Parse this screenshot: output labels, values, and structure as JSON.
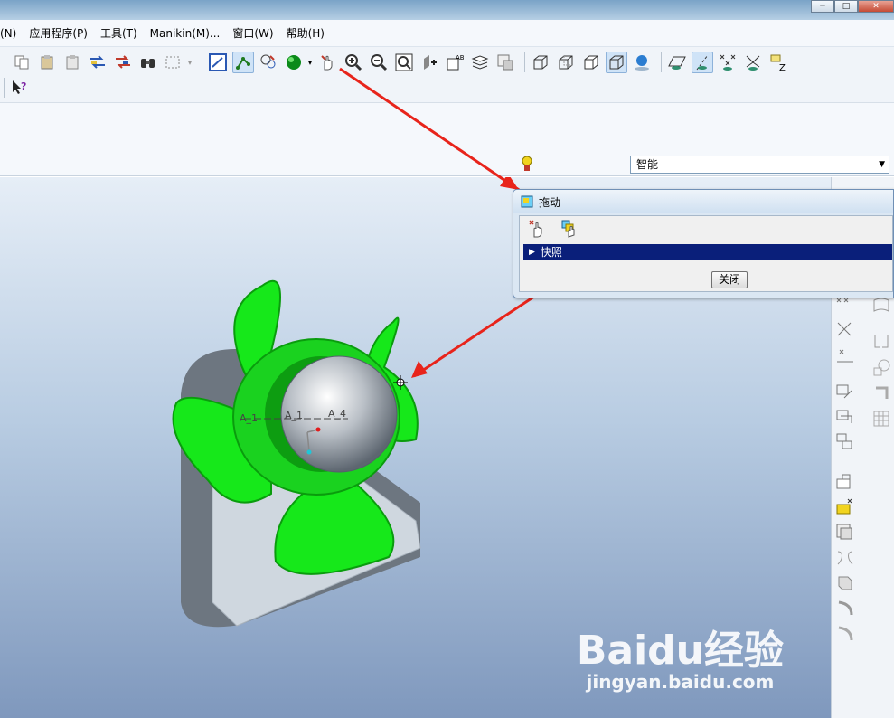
{
  "window": {
    "controls": [
      "─",
      "□",
      "✕"
    ]
  },
  "menubar": {
    "items": [
      {
        "label": "(N)"
      },
      {
        "label": "应用程序(P)"
      },
      {
        "label": "工具(T)"
      },
      {
        "label": "Manikin(M)..."
      },
      {
        "label": "窗口(W)"
      },
      {
        "label": "帮助(H)"
      }
    ]
  },
  "toolbar": {
    "row1_icons": [
      "copy-icon",
      "paste-icon",
      "paste-special-icon",
      "regenerate-icon",
      "regenerate-manager-icon",
      "find-icon",
      "select-box-icon",
      "refit-icon",
      "spin-center-icon",
      "datum-display-icon",
      "appearance-icon",
      "drag-components-icon",
      "zoom-in-icon",
      "zoom-out-icon",
      "refit-view-icon",
      "reorient-icon",
      "saved-views-icon",
      "layers-icon",
      "view-manager-icon",
      "wireframe-icon",
      "hidden-line-icon",
      "no-hidden-icon",
      "shading-icon",
      "enhanced-realism-icon",
      "datum-planes-icon",
      "datum-axes-icon",
      "datum-points-icon",
      "coord-sys-icon",
      "annotation-icon"
    ],
    "row2_icons": [
      "context-help-icon"
    ]
  },
  "filter": {
    "selected": "智能",
    "light_icon": "light-bulb-icon"
  },
  "dialog": {
    "title": "拖动",
    "tools": [
      "drag-point-icon",
      "drag-body-icon"
    ],
    "snapshot_label": "快照",
    "close_label": "关闭"
  },
  "model": {
    "axis_labels": [
      "A_1",
      "A_1",
      "A_4"
    ]
  },
  "right_rail": {
    "icons": [
      "datum-point-icon",
      "datum-csys-icon",
      "datum-curve-icon",
      "sketch-icon",
      "extrude-icon",
      "revolve-icon",
      "sweep-icon",
      "blend-icon",
      "round-icon",
      "chamfer-icon",
      "hole-icon",
      "shell-icon",
      "rib-icon",
      "draft-icon",
      "pattern-icon",
      "mirror-icon"
    ]
  },
  "watermark": {
    "brand": "Baidu经验",
    "url": "jingyan.baidu.com"
  },
  "colors": {
    "fan_green": "#16e81a",
    "viewport_top": "#e6eef7",
    "viewport_bottom": "#7f98bd",
    "arrow_red": "#e8241b"
  }
}
